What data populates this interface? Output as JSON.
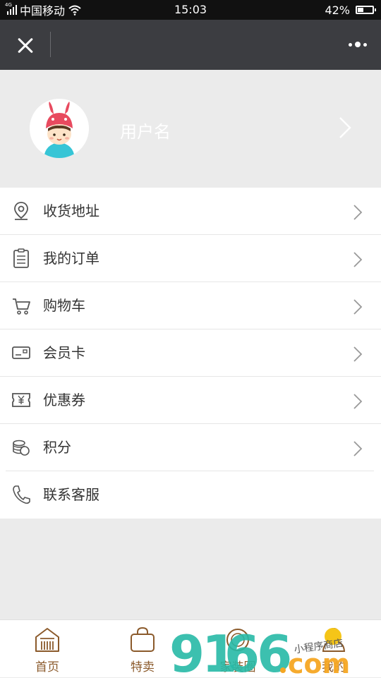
{
  "status_bar": {
    "network": "4G",
    "carrier": "中国移动",
    "time": "15:03",
    "battery": "42%",
    "battery_level": 0.42
  },
  "nav": {
    "close_icon": "close-icon",
    "more_icon": "more-dots-icon"
  },
  "profile": {
    "username": "用户名"
  },
  "menu": {
    "items": [
      {
        "label": "收货地址",
        "icon": "location-pin-icon"
      },
      {
        "label": "我的订单",
        "icon": "clipboard-icon"
      },
      {
        "label": "购物车",
        "icon": "shopping-cart-icon"
      },
      {
        "label": "会员卡",
        "icon": "member-card-icon"
      },
      {
        "label": "优惠券",
        "icon": "coupon-icon"
      },
      {
        "label": "积分",
        "icon": "points-coins-icon"
      },
      {
        "label": "联系客服",
        "icon": "phone-icon"
      }
    ]
  },
  "tabbar": {
    "tabs": [
      {
        "label": "首页",
        "icon": "home-icon"
      },
      {
        "label": "特卖",
        "icon": "shopping-bag-icon"
      },
      {
        "label": "家装圈",
        "icon": "circle-icon"
      },
      {
        "label": "我的",
        "icon": "user-icon"
      }
    ]
  },
  "watermark": {
    "text": "9166.com",
    "tagline": "小程序商店"
  },
  "colors": {
    "status_bar": "#111111",
    "nav_bar": "#3c3d41",
    "background": "#ebebeb",
    "tab_label": "#8b5a2b",
    "watermark_teal": "#27b9a6",
    "watermark_orange": "#f5a623"
  }
}
